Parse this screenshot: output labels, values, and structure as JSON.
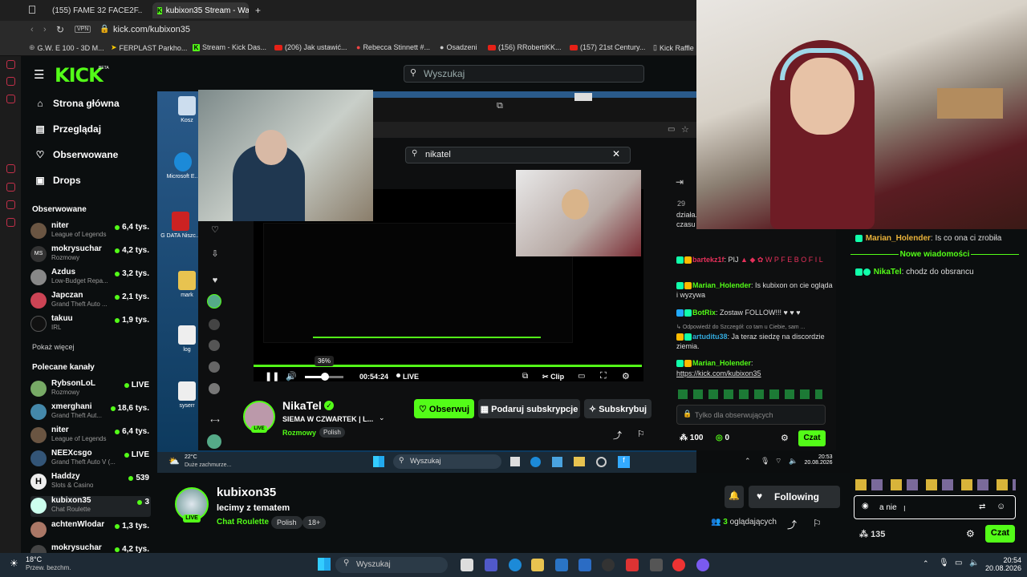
{
  "browser": {
    "tabs": [
      {
        "label": "(155) FAME 32 FACE2F..."
      },
      {
        "label": "kubixon35 Stream - Wa..."
      }
    ],
    "new_tab": "+",
    "vpn": "VPN",
    "url": "kick.com/kubixon35",
    "bookmarks": [
      "G.W. E 100 - 3D M...",
      "FERPLAST Parkho...",
      "Stream - Kick Das...",
      "(206) Jak ustawić...",
      "Rebecca Stinnett #...",
      "Osadzeni",
      "(156) RRobertiKK...",
      "(157) 21st Century...",
      "Kick Raffle"
    ]
  },
  "kick": {
    "logo": "KICK",
    "beta": "BETA",
    "search_placeholder": "Wyszukaj",
    "nav": [
      {
        "label": "Strona główna",
        "icon": "home-icon"
      },
      {
        "label": "Przeglądaj",
        "icon": "browse-icon"
      },
      {
        "label": "Obserwowane",
        "icon": "heart-icon"
      },
      {
        "label": "Drops",
        "icon": "drops-icon"
      }
    ],
    "followed_title": "Obserwowane",
    "followed": [
      {
        "name": "niter",
        "category": "League of Legends",
        "viewers": "6,4 tys."
      },
      {
        "name": "mokrysuchar",
        "category": "Rozmowy",
        "viewers": "4,2 tys."
      },
      {
        "name": "Azdus",
        "category": "Low-Budget Repa...",
        "viewers": "3,2 tys."
      },
      {
        "name": "Japczan",
        "category": "Grand Theft Auto ...",
        "viewers": "2,1 tys."
      },
      {
        "name": "takuu",
        "category": "IRL",
        "viewers": "1,9 tys."
      }
    ],
    "show_more": "Pokaż więcej",
    "recommended_title": "Polecane kanały",
    "recommended": [
      {
        "name": "RybsonLoL",
        "category": "Rozmowy",
        "viewers": "LIVE"
      },
      {
        "name": "xmerghani",
        "category": "Grand Theft Aut...",
        "viewers": "18,6 tys."
      },
      {
        "name": "niter",
        "category": "League of Legends",
        "viewers": "6,4 tys."
      },
      {
        "name": "NEEXcsgo",
        "category": "Grand Theft Auto V (...",
        "viewers": "LIVE"
      },
      {
        "name": "Haddzy",
        "category": "Slots & Casino",
        "viewers": "539"
      },
      {
        "name": "kubixon35",
        "category": "Chat Roulette",
        "viewers": "3"
      },
      {
        "name": "achtenWlodar",
        "category": "",
        "viewers": "1,3 tys."
      },
      {
        "name": "mokrysuchar",
        "category": "",
        "viewers": "4,2 tys."
      }
    ]
  },
  "remote": {
    "desktop_icons": [
      "Kosz",
      "Microsoft E...",
      "G DATA Niszc...",
      "mark",
      "log",
      "syserr"
    ],
    "search_value": "nikatel",
    "player": {
      "volume_tooltip": "36%",
      "time": "00:54:24",
      "live": "LIVE",
      "clip": "Clip"
    },
    "streamer": "NikaTel",
    "title": "SIEMA W CZWARTEK | L...",
    "category": "Rozmowy",
    "tag": "Polish",
    "follow": "Obserwuj",
    "gift": "Podaruj subskrypcje",
    "subscribe": "Subskrybuj",
    "viewer_count": "29",
    "chat": [
      {
        "user": "",
        "text": "działa... serwera? pamiętam jak dzisiaj, zajebiste czasu"
      },
      {
        "user": "bartekz1f",
        "text": ": PIJ"
      },
      {
        "user": "Marian_Holender",
        "text": ": Is kubixon on cie ogląda i wyzywa"
      },
      {
        "user": "BotRix",
        "text": ": Zostaw FOLLOW!!! ♥ ♥ ♥"
      },
      {
        "user": "",
        "text": "Odpowiedź do Szczegół: co tam u Ciebie, sam ..."
      },
      {
        "user": "artuditu38",
        "text": ": Ja teraz siedzę na discordzie ziemia."
      },
      {
        "user": "Marian_Holender",
        "text": ":"
      },
      {
        "user": "",
        "text": "https://kick.com/kubixon35"
      }
    ],
    "chat_placeholder": "Tylko dla obserwujących",
    "points": "100",
    "zero": "0",
    "chat_btn": "Czat",
    "taskbar": {
      "weather_temp": "22°C",
      "weather_desc": "Duże zachmurze...",
      "search": "Wyszukaj",
      "time": "20:53",
      "date": "20.08.2026"
    }
  },
  "channel": {
    "name": "kubixon35",
    "title": "lecimy z tematem",
    "category": "Chat Roulette",
    "tags": [
      "Polish",
      "18+"
    ],
    "live": "LIVE",
    "following": "Following",
    "viewers_count": "3",
    "viewers_label": "oglądających"
  },
  "chat": {
    "messages": [
      {
        "user": "Marian_Holender",
        "text": ": Is co ona ci zrobiła"
      },
      {
        "user": "NikaTel",
        "text": ": chodz do obsrancu"
      }
    ],
    "new_messages": "Nowe wiadomości",
    "input_value": "a nie",
    "points": "135",
    "send": "Czat"
  },
  "windows": {
    "weather_temp": "18°C",
    "weather_desc": "Przew. bezchm.",
    "search": "Wyszukaj",
    "time": "20:54",
    "date": "20.08.2026"
  },
  "colors": {
    "accent": "#53fc18",
    "bg": "#0b0e0f"
  }
}
